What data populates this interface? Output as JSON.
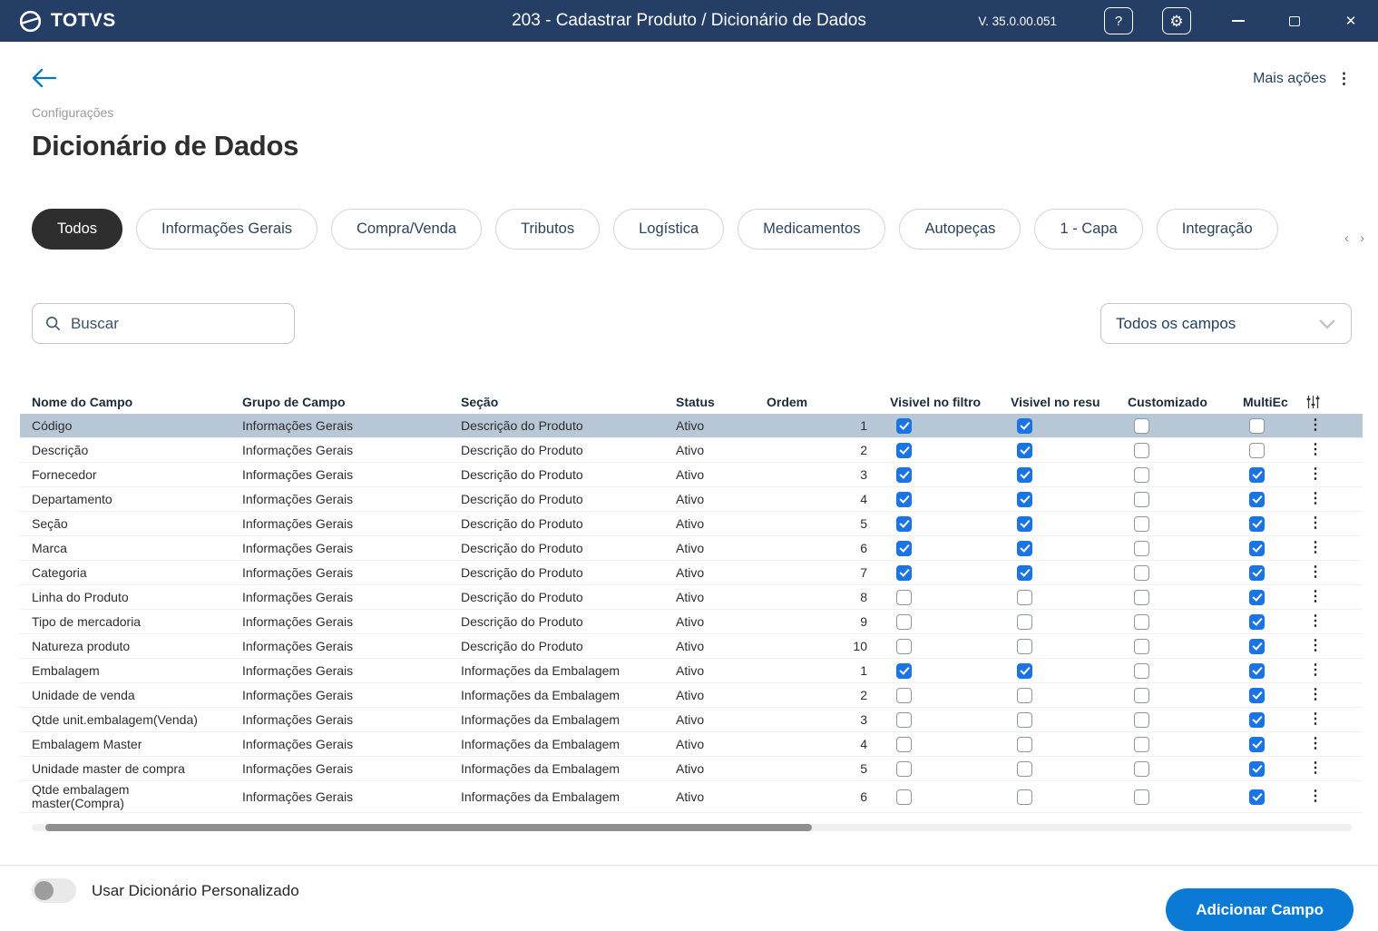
{
  "titlebar": {
    "logo_text": "TOTVS",
    "title": "203 - Cadastrar Produto / Dicionário de Dados",
    "version": "V. 35.0.00.051",
    "help_label": "?"
  },
  "toolbar": {
    "more_actions_label": "Mais ações"
  },
  "breadcrumb": {
    "label": "Configurações"
  },
  "page": {
    "title": "Dicionário de Dados"
  },
  "tabs": [
    {
      "label": "Todos",
      "active": true
    },
    {
      "label": "Informações Gerais",
      "active": false
    },
    {
      "label": "Compra/Venda",
      "active": false
    },
    {
      "label": "Tributos",
      "active": false
    },
    {
      "label": "Logística",
      "active": false
    },
    {
      "label": "Medicamentos",
      "active": false
    },
    {
      "label": "Autopeças",
      "active": false
    },
    {
      "label": "1 - Capa",
      "active": false
    },
    {
      "label": "Integração",
      "active": false
    }
  ],
  "search": {
    "placeholder": "Buscar"
  },
  "field_filter": {
    "value": "Todos os campos"
  },
  "table": {
    "headers": {
      "nome": "Nome do Campo",
      "grupo": "Grupo de Campo",
      "secao": "Seção",
      "status": "Status",
      "ordem": "Ordem",
      "filtro": "Visivel no filtro",
      "resultado": "Visivel no resu",
      "customizado": "Customizado",
      "multi": "MultiEc"
    },
    "rows": [
      {
        "nome": "Código",
        "grupo": "Informações Gerais",
        "secao": "Descrição do Produto",
        "status": "Ativo",
        "ordem": "1",
        "filtro": true,
        "resultado": true,
        "customizado": false,
        "multi": false,
        "selected": true
      },
      {
        "nome": "Descrição",
        "grupo": "Informações Gerais",
        "secao": "Descrição do Produto",
        "status": "Ativo",
        "ordem": "2",
        "filtro": true,
        "resultado": true,
        "customizado": false,
        "multi": false,
        "selected": false
      },
      {
        "nome": "Fornecedor",
        "grupo": "Informações Gerais",
        "secao": "Descrição do Produto",
        "status": "Ativo",
        "ordem": "3",
        "filtro": true,
        "resultado": true,
        "customizado": false,
        "multi": true,
        "selected": false
      },
      {
        "nome": "Departamento",
        "grupo": "Informações Gerais",
        "secao": "Descrição do Produto",
        "status": "Ativo",
        "ordem": "4",
        "filtro": true,
        "resultado": true,
        "customizado": false,
        "multi": true,
        "selected": false
      },
      {
        "nome": "Seção",
        "grupo": "Informações Gerais",
        "secao": "Descrição do Produto",
        "status": "Ativo",
        "ordem": "5",
        "filtro": true,
        "resultado": true,
        "customizado": false,
        "multi": true,
        "selected": false
      },
      {
        "nome": "Marca",
        "grupo": "Informações Gerais",
        "secao": "Descrição do Produto",
        "status": "Ativo",
        "ordem": "6",
        "filtro": true,
        "resultado": true,
        "customizado": false,
        "multi": true,
        "selected": false
      },
      {
        "nome": "Categoria",
        "grupo": "Informações Gerais",
        "secao": "Descrição do Produto",
        "status": "Ativo",
        "ordem": "7",
        "filtro": true,
        "resultado": true,
        "customizado": false,
        "multi": true,
        "selected": false
      },
      {
        "nome": "Linha do Produto",
        "grupo": "Informações Gerais",
        "secao": "Descrição do Produto",
        "status": "Ativo",
        "ordem": "8",
        "filtro": false,
        "resultado": false,
        "customizado": false,
        "multi": true,
        "selected": false
      },
      {
        "nome": "Tipo de mercadoria",
        "grupo": "Informações Gerais",
        "secao": "Descrição do Produto",
        "status": "Ativo",
        "ordem": "9",
        "filtro": false,
        "resultado": false,
        "customizado": false,
        "multi": true,
        "selected": false
      },
      {
        "nome": "Natureza produto",
        "grupo": "Informações Gerais",
        "secao": "Descrição do Produto",
        "status": "Ativo",
        "ordem": "10",
        "filtro": false,
        "resultado": false,
        "customizado": false,
        "multi": true,
        "selected": false
      },
      {
        "nome": "Embalagem",
        "grupo": "Informações Gerais",
        "secao": "Informações da Embalagem",
        "status": "Ativo",
        "ordem": "1",
        "filtro": true,
        "resultado": true,
        "customizado": false,
        "multi": true,
        "selected": false
      },
      {
        "nome": "Unidade de venda",
        "grupo": "Informações Gerais",
        "secao": "Informações da Embalagem",
        "status": "Ativo",
        "ordem": "2",
        "filtro": false,
        "resultado": false,
        "customizado": false,
        "multi": true,
        "selected": false
      },
      {
        "nome": "Qtde unit.embalagem(Venda)",
        "grupo": "Informações Gerais",
        "secao": "Informações da Embalagem",
        "status": "Ativo",
        "ordem": "3",
        "filtro": false,
        "resultado": false,
        "customizado": false,
        "multi": true,
        "selected": false
      },
      {
        "nome": "Embalagem Master",
        "grupo": "Informações Gerais",
        "secao": "Informações da Embalagem",
        "status": "Ativo",
        "ordem": "4",
        "filtro": false,
        "resultado": false,
        "customizado": false,
        "multi": true,
        "selected": false
      },
      {
        "nome": "Unidade master de compra",
        "grupo": "Informações Gerais",
        "secao": "Informações da Embalagem",
        "status": "Ativo",
        "ordem": "5",
        "filtro": false,
        "resultado": false,
        "customizado": false,
        "multi": true,
        "selected": false
      },
      {
        "nome": "Qtde embalagem master(Compra)",
        "grupo": "Informações Gerais",
        "secao": "Informações da Embalagem",
        "status": "Ativo",
        "ordem": "6",
        "filtro": false,
        "resultado": false,
        "customizado": false,
        "multi": true,
        "selected": false
      }
    ]
  },
  "footer": {
    "toggle_label": "Usar Dicionário Personalizado",
    "toggle_on": false,
    "add_button_label": "Adicionar Campo"
  },
  "colors": {
    "titlebar_bg": "#253e66",
    "accent_blue": "#1b74e4",
    "selected_row_bg": "#b7c7d6",
    "primary_button_bg": "#0a7ad4",
    "active_tab_bg": "#2e2e2e",
    "link_blue": "#0079b8"
  }
}
